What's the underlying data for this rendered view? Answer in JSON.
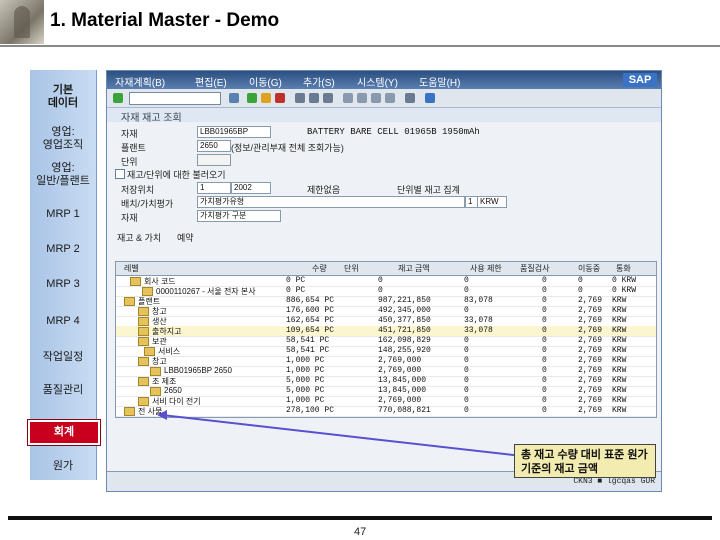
{
  "slide": {
    "title": "1. Material Master - Demo",
    "page_number": "47"
  },
  "sidebar": {
    "items": [
      {
        "label": "기본\n데이터"
      },
      {
        "label": "영업:\n영업조직"
      },
      {
        "label": "영업:\n일반/플랜트"
      },
      {
        "label": "MRP 1"
      },
      {
        "label": "MRP 2"
      },
      {
        "label": "MRP 3"
      },
      {
        "label": "MRP 4"
      },
      {
        "label": "작업일정"
      },
      {
        "label": "품질관리"
      },
      {
        "label": "회계"
      },
      {
        "label": "원가"
      }
    ]
  },
  "sap": {
    "menu_items": [
      "자재계획(B)",
      "편집(E)",
      "이동(G)",
      "추가(S)",
      "시스템(Y)",
      "도움말(H)"
    ],
    "logo_text": "SAP",
    "breadcrumb": "자재 재고 조회",
    "fields": {
      "material_label": "자재",
      "material_value": "LBB01965BP",
      "material_desc": "BATTERY BARE CELL 01965B 1950mAh",
      "plant_label": "플랜트",
      "plant_value": "2650",
      "plant_note": "(정보/관리부재 전체 조회가능)",
      "unit_label": "단위",
      "chk_label": "재고/단위에 대한 불러오기",
      "storage_label": "저장위치",
      "storage_value": "1",
      "storage_name": "2002",
      "batch_label": "배치/가치평가",
      "batch_value": "가치평가유형",
      "unrestricted_label": "제한없음",
      "unit_note": "단위별 재고 집계",
      "qty_unit": "KRW",
      "qty_code": "1",
      "special_label": "자재",
      "special_value": "가치평가 구분",
      "tab_stock": "재고 & 가치",
      "tab_val": "예약"
    },
    "table": {
      "headers": [
        "레벨",
        "수량",
        "단위",
        "재고 금액",
        "사용 제한",
        "품질검사",
        "이동중",
        "통화"
      ],
      "rows": [
        {
          "level": "회사 코드",
          "qty": "0 PC",
          "amount": "0",
          "restricted": "0",
          "qc": "0",
          "transit": "0",
          "currency": "0 KRW"
        },
        {
          "level": "0000110267 - 서울 전자 본사",
          "qty": "0 PC",
          "amount": "0",
          "restricted": "0",
          "qc": "0",
          "transit": "0",
          "currency": "0 KRW"
        },
        {
          "level": "플랜트",
          "qty": "886,654 PC",
          "amount": "987,221,850",
          "restricted": "83,078",
          "qc": "0",
          "transit": "2,769",
          "currency": "KRW"
        },
        {
          "level": "창고",
          "qty": "176,600 PC",
          "amount": "492,345,000",
          "restricted": "0",
          "qc": "0",
          "transit": "2,769",
          "currency": "KRW"
        },
        {
          "level": "생산",
          "qty": "162,654 PC",
          "amount": "450,377,850",
          "restricted": "33,078",
          "qc": "0",
          "transit": "2,769",
          "currency": "KRW"
        },
        {
          "level": "출하지고",
          "qty": "109,654 PC",
          "amount": "451,721,850",
          "restricted": "33,078",
          "qc": "0",
          "transit": "2,769",
          "currency": "KRW"
        },
        {
          "level": "보관",
          "qty": "58,541 PC",
          "amount": "162,098,829",
          "restricted": "0",
          "qc": "0",
          "transit": "2,769",
          "currency": "KRW"
        },
        {
          "level": "서비스",
          "qty": "58,541 PC",
          "amount": "148,255,920",
          "restricted": "0",
          "qc": "0",
          "transit": "2,769",
          "currency": "KRW"
        },
        {
          "level": "창고",
          "qty": "1,000 PC",
          "amount": "2,769,000",
          "restricted": "0",
          "qc": "0",
          "transit": "2,769",
          "currency": "KRW"
        },
        {
          "level": "LBB01965BP 2650",
          "qty": "1,000 PC",
          "amount": "2,769,000",
          "restricted": "0",
          "qc": "0",
          "transit": "2,769",
          "currency": "KRW"
        },
        {
          "level": "조 제조",
          "qty": "5,000 PC",
          "amount": "13,845,000",
          "restricted": "0",
          "qc": "0",
          "transit": "2,769",
          "currency": "KRW"
        },
        {
          "level": "2650",
          "qty": "5,000 PC",
          "amount": "13,845,000",
          "restricted": "0",
          "qc": "0",
          "transit": "2,769",
          "currency": "KRW"
        },
        {
          "level": "서비 다이 전기",
          "qty": "1,000 PC",
          "amount": "2,769,000",
          "restricted": "0",
          "qc": "0",
          "transit": "2,769",
          "currency": "KRW"
        },
        {
          "level": "전 사물",
          "qty": "278,100 PC",
          "amount": "770,088,821",
          "restricted": "0",
          "qc": "0",
          "transit": "2,769",
          "currency": "KRW"
        }
      ]
    },
    "status_text": "CKN3 ■ lgcqas  GUR"
  },
  "callout": {
    "text": "총 재고 수량 대비 표준 원가 기준의 재고 금액"
  },
  "colors": {
    "menubar": "#2b4f80",
    "sidebar": "#a9c4e6",
    "highlight_row": "#fbf6cf",
    "accent_red": "#c8001e",
    "callout_bg": "#f3ecb0"
  }
}
